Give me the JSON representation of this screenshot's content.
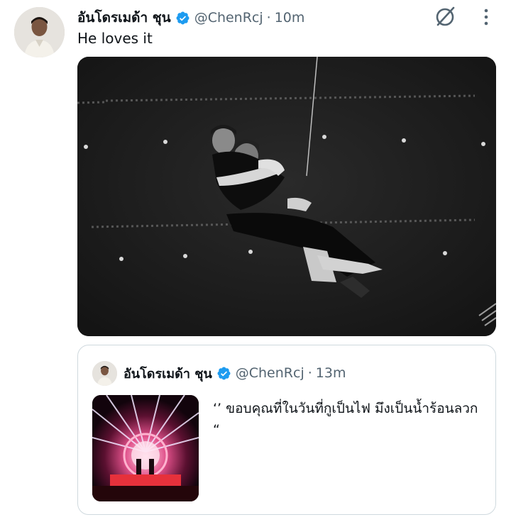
{
  "tweet": {
    "author_name": "อันโดรเมด้า ชุน",
    "handle": "@ChenRcj",
    "separator": "·",
    "time": "10m",
    "text": "He loves it",
    "media_icon": "photo-image-icon",
    "avatar_icon": "profile-photo-icon",
    "verified_icon": "verified-badge-icon",
    "grok_icon": "grok-slash-icon",
    "more_icon": "more-dots-icon"
  },
  "quote": {
    "author_name": "อันโดรเมด้า ชุน",
    "handle": "@ChenRcj",
    "separator": "·",
    "time": "13m",
    "text": "‘’ ขอบคุณที่ในวันที่กูเป็นไฟ มึงเป็นน้ำร้อนลวก “",
    "thumb_icon": "concert-stage-photo-icon"
  },
  "colors": {
    "text_primary": "#0f1419",
    "text_secondary": "#536471",
    "verified_blue": "#1d9bf0",
    "border": "#cfd9de"
  }
}
